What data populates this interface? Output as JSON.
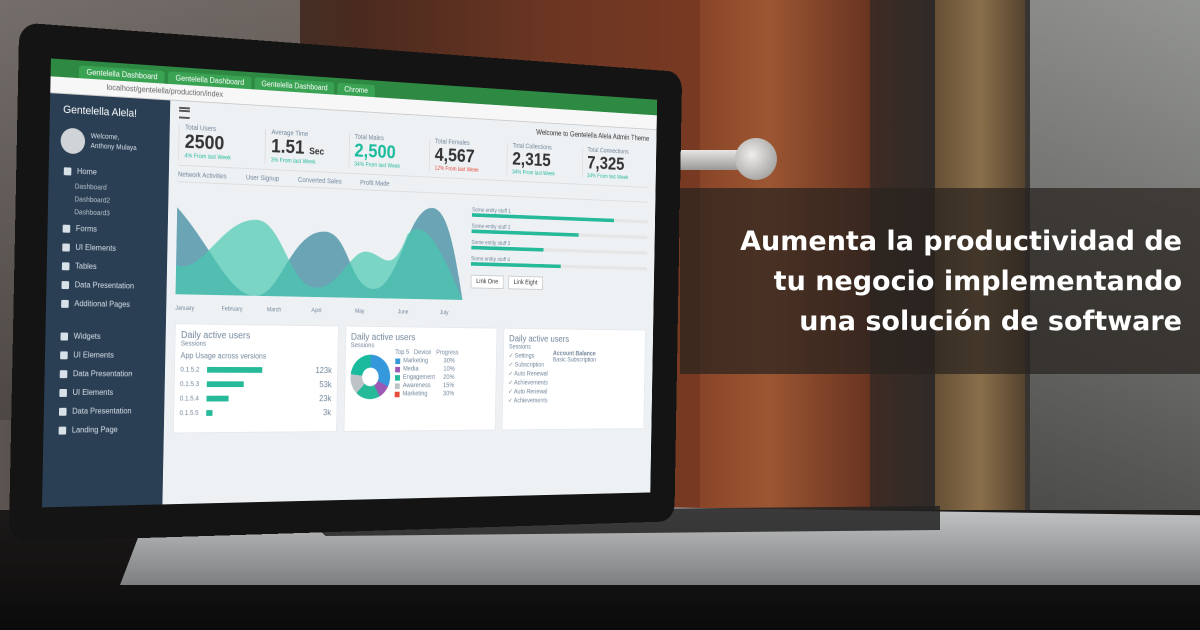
{
  "headline": {
    "line1": "Aumenta la productividad de",
    "line2": "tu negocio implementando",
    "line3": "una solución de software"
  },
  "laptop_screen": {
    "tabs": [
      "Gentelella Dashboard",
      "Gentelella Dashboard",
      "Gentelella Dashboard",
      "Chrome"
    ],
    "address": "localhost/gentelella/production/index",
    "brand": "Gentelella Alela!",
    "welcome": "Welcome,",
    "user": "Anthony Mulaya",
    "top_message": "Welcome to Gentelella Alela Admin Theme",
    "nav": [
      {
        "label": "Home",
        "subs": [
          "Dashboard",
          "Dashboard2",
          "Dashboard3"
        ]
      },
      {
        "label": "Forms"
      },
      {
        "label": "UI Elements"
      },
      {
        "label": "Tables"
      },
      {
        "label": "Data Presentation"
      },
      {
        "label": "Additional Pages"
      },
      {
        "label": "Widgets"
      },
      {
        "label": "UI Elements"
      },
      {
        "label": "Data Presentation"
      },
      {
        "label": "UI Elements"
      },
      {
        "label": "Data Presentation"
      },
      {
        "label": "Landing Page"
      }
    ],
    "stats": [
      {
        "label": "Total Users",
        "value": "2500",
        "sub": "4% From last Week"
      },
      {
        "label": "Average Time",
        "value": "1.51",
        "unit": "Sec",
        "sub": "3% From last Week"
      },
      {
        "label": "Total Males",
        "value": "2,500",
        "sub": "34% From last Week"
      },
      {
        "label": "Total Females",
        "value": "4,567",
        "sub": "12% From last Week"
      },
      {
        "label": "Total Collections",
        "value": "2,315",
        "sub": "34% From last Week"
      },
      {
        "label": "Total Connections",
        "value": "7,325",
        "sub": "34% From last Week"
      }
    ],
    "chart_tabs": [
      "Network Activities",
      "User Signup",
      "Converted Sales",
      "Profit Made"
    ],
    "months": [
      "January",
      "February",
      "March",
      "April",
      "May",
      "June",
      "July"
    ],
    "progress": [
      {
        "label": "Some entity stuff 1",
        "value": 0.8
      },
      {
        "label": "Some entity stuff 2",
        "value": 0.6
      },
      {
        "label": "Some entity stuff 3",
        "value": 0.4
      },
      {
        "label": "Some entity stuff 4",
        "value": 0.5
      }
    ],
    "buttons": [
      "Link One",
      "Link Eight"
    ],
    "panels": {
      "p1_title": "Daily active users",
      "p1_sub": "Sessions",
      "p1_heading": "App Usage across versions",
      "versions": [
        {
          "label": "0.1.5.2",
          "value": "123k",
          "fill": 0.9
        },
        {
          "label": "0.1.5.3",
          "value": "53k",
          "fill": 0.6
        },
        {
          "label": "0.1.5.4",
          "value": "23k",
          "fill": 0.35
        },
        {
          "label": "0.1.5.5",
          "value": "3k",
          "fill": 0.1
        }
      ],
      "p2_title": "Daily active users",
      "p2_sub": "Sessions",
      "p2_cols": [
        "Top 5",
        "Device",
        "Progress"
      ],
      "p2_rows": [
        {
          "label": "Marketing",
          "value": "30%"
        },
        {
          "label": "Media",
          "value": "10%"
        },
        {
          "label": "Engagement",
          "value": "20%"
        },
        {
          "label": "Awareness",
          "value": "15%"
        },
        {
          "label": "Marketing",
          "value": "30%"
        }
      ],
      "p3_title": "Daily active users",
      "p3_sub": "Sessions",
      "p3_items": [
        "Settings",
        "Subscription",
        "Auto Renewal",
        "Achievements",
        "Auto Renewal",
        "Achievements"
      ],
      "p3_balance_title": "Account Balance",
      "p3_balance_lines": [
        "Basic Subscription"
      ]
    }
  }
}
